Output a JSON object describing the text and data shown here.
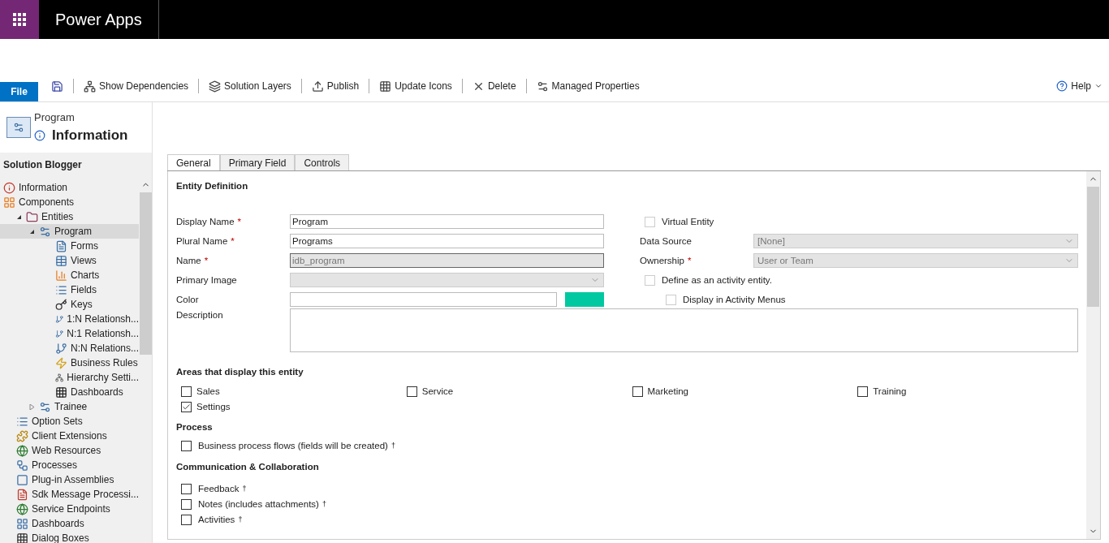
{
  "app_bar": {
    "title": "Power Apps"
  },
  "toolbar": {
    "file": "File",
    "items": [
      {
        "kind": "save"
      },
      {
        "kind": "deps",
        "label": "Show Dependencies"
      },
      {
        "kind": "layers",
        "label": "Solution Layers"
      },
      {
        "kind": "publish",
        "label": "Publish"
      },
      {
        "kind": "grid",
        "label": "Update Icons"
      },
      {
        "kind": "delete",
        "label": "Delete"
      },
      {
        "kind": "props",
        "label": "Managed Properties"
      }
    ],
    "help": "Help"
  },
  "header": {
    "entity": "Program",
    "page": "Information"
  },
  "sidebar": {
    "solution": "Solution Blogger",
    "items": [
      {
        "label": "Information",
        "selected": false
      },
      {
        "label": "Components",
        "selected": false,
        "children": [
          {
            "label": "Entities",
            "expanded": true,
            "selected": false,
            "children": [
              {
                "label": "Program",
                "expanded": true,
                "selected": true,
                "children": [
                  {
                    "label": "Forms",
                    "selected": false
                  },
                  {
                    "label": "Views",
                    "selected": false
                  },
                  {
                    "label": "Charts",
                    "selected": false
                  },
                  {
                    "label": "Fields",
                    "selected": false
                  },
                  {
                    "label": "Keys",
                    "selected": false
                  },
                  {
                    "label": "1:N Relationsh...",
                    "selected": false
                  },
                  {
                    "label": "N:1 Relationsh...",
                    "selected": false
                  },
                  {
                    "label": "N:N Relations...",
                    "selected": false
                  },
                  {
                    "label": "Business Rules",
                    "selected": false
                  },
                  {
                    "label": "Hierarchy Setti...",
                    "selected": false
                  },
                  {
                    "label": "Dashboards",
                    "selected": false
                  }
                ]
              },
              {
                "label": "Trainee",
                "expanded": false,
                "selected": false
              }
            ]
          },
          {
            "label": "Option Sets",
            "selected": false
          },
          {
            "label": "Client Extensions",
            "selected": false
          },
          {
            "label": "Web Resources",
            "selected": false
          },
          {
            "label": "Processes",
            "selected": false
          },
          {
            "label": "Plug-in Assemblies",
            "selected": false
          },
          {
            "label": "Sdk Message Processi...",
            "selected": false
          },
          {
            "label": "Service Endpoints",
            "selected": false
          },
          {
            "label": "Dashboards",
            "selected": false
          },
          {
            "label": "Dialog Boxes",
            "selected": false
          }
        ]
      }
    ]
  },
  "tabs": [
    {
      "label": "General",
      "selected": true
    },
    {
      "label": "Primary Field",
      "selected": false
    },
    {
      "label": "Controls",
      "selected": false
    }
  ],
  "entity_definition": {
    "heading": "Entity Definition",
    "fields": [
      {
        "label": "Display Name",
        "mark": "*",
        "kind": "text",
        "value": "Program",
        "disabled": false
      },
      {
        "label": "Plural Name",
        "mark": "*",
        "kind": "text",
        "value": "Programs",
        "disabled": false
      },
      {
        "label": "Name",
        "mark": "*",
        "kind": "text",
        "value": "idb_program",
        "disabled": true
      },
      {
        "label": "Primary Image",
        "kind": "select",
        "disabled": true
      },
      {
        "label": "Color",
        "kind": "color",
        "color": "#00c8a0",
        "disabled": false
      },
      {
        "label": "Description",
        "kind": "textarea",
        "disabled": false
      }
    ],
    "right": [
      {
        "kind": "check",
        "label": "Virtual Entity",
        "checked": false,
        "disabled": true
      },
      {
        "kind": "select",
        "label": "Data Source",
        "value": "[None]",
        "disabled": true
      },
      {
        "kind": "select",
        "label": "Ownership",
        "mark": "*",
        "value": "User or Team",
        "disabled": true
      },
      {
        "kind": "check",
        "label": "Define as an activity entity.",
        "checked": false,
        "disabled": true
      },
      {
        "kind": "subcheck",
        "label": "Display in Activity Menus",
        "checked": false,
        "disabled": true
      }
    ]
  },
  "areas": {
    "heading": "Areas that display this entity",
    "items": [
      {
        "label": "Sales",
        "checked": false
      },
      {
        "label": "Service",
        "checked": false
      },
      {
        "label": "Marketing",
        "checked": false
      },
      {
        "label": "Training",
        "checked": false
      },
      {
        "label": "Settings",
        "checked": true
      }
    ]
  },
  "process": {
    "heading": "Process",
    "items": [
      {
        "label": "Business process flows (fields will be created)",
        "note": "†",
        "checked": false
      }
    ]
  },
  "communication": {
    "heading": "Communication & Collaboration",
    "items": [
      {
        "label": "Feedback",
        "note": "†",
        "checked": false
      },
      {
        "label": "Notes (includes attachments)",
        "note": "†",
        "checked": false
      },
      {
        "label": "Activities",
        "note": "†",
        "checked": false
      }
    ]
  }
}
